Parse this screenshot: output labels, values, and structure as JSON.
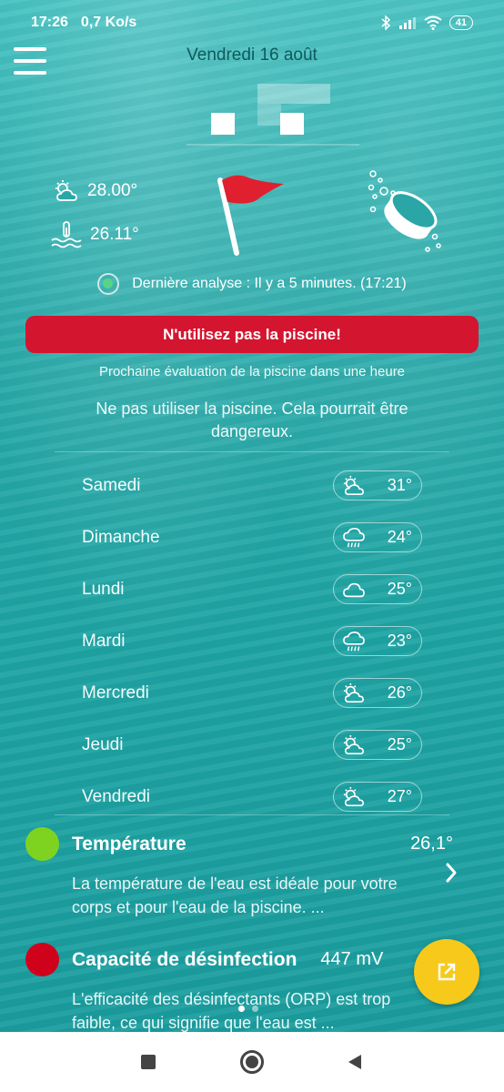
{
  "status_bar": {
    "time": "17:26",
    "speed": "0,7 Ko/s",
    "battery": "41"
  },
  "header": {
    "date": "Vendredi 16 août"
  },
  "current": {
    "air_temp": "28.00°",
    "water_temp": "26.11°"
  },
  "analysis": {
    "text": "Dernière analyse : Il y a 5 minutes. (17:21)"
  },
  "alert": {
    "label": "N'utilisez pas la piscine!"
  },
  "next_evaluation": "Prochaine évaluation de la piscine dans une heure",
  "advice": "Ne pas utiliser la piscine. Cela pourrait être dangereux.",
  "forecast": [
    {
      "day": "Samedi",
      "icon": "partly-sunny-icon",
      "temp": "31°"
    },
    {
      "day": "Dimanche",
      "icon": "rain-icon",
      "temp": "24°"
    },
    {
      "day": "Lundi",
      "icon": "cloud-icon",
      "temp": "25°"
    },
    {
      "day": "Mardi",
      "icon": "rain-icon",
      "temp": "23°"
    },
    {
      "day": "Mercredi",
      "icon": "partly-sunny-icon",
      "temp": "26°"
    },
    {
      "day": "Jeudi",
      "icon": "partly-sunny-icon",
      "temp": "25°"
    },
    {
      "day": "Vendredi",
      "icon": "partly-sunny-icon",
      "temp": "27°"
    }
  ],
  "parameters": [
    {
      "title": "Température",
      "value": "26,1°",
      "status_color": "#7ed321",
      "description": "La température de l'eau est idéale pour votre corps et pour l'eau de la piscine. ..."
    },
    {
      "title": "Capacité de désinfection",
      "value": "447 mV",
      "status_color": "#d0021b",
      "description": "L'efficacité des désinfectants (ORP) est trop faible, ce qui signifie que l'eau est ..."
    }
  ],
  "colors": {
    "alert": "#d41530",
    "fab": "#f7c91b",
    "flag": "#e0202e"
  }
}
